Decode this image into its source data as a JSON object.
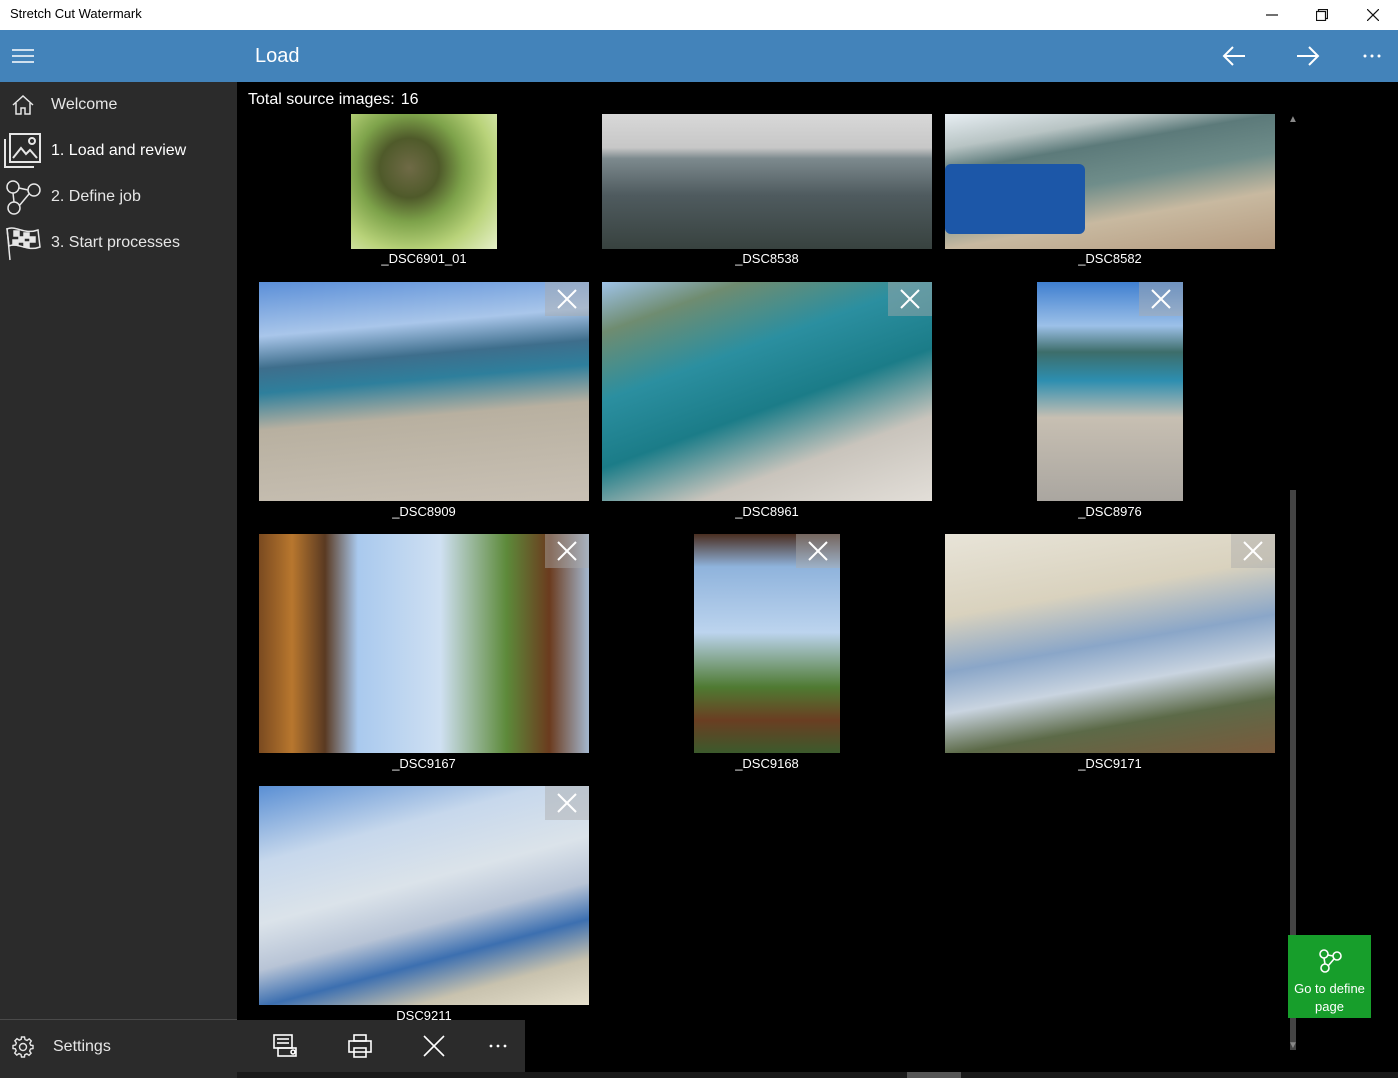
{
  "window": {
    "title": "Stretch Cut Watermark"
  },
  "header": {
    "title": "Load"
  },
  "nav": {
    "items": [
      {
        "label": "Welcome"
      },
      {
        "label": "1. Load and review"
      },
      {
        "label": "2. Define job"
      },
      {
        "label": "3. Start processes"
      }
    ],
    "settings_label": "Settings"
  },
  "main": {
    "total_label": "Total source images:",
    "total_count": "16",
    "images": [
      {
        "name": "_DSC6901_01",
        "scene": "tree",
        "removable": false
      },
      {
        "name": "_DSC8538",
        "scene": "sea-grey",
        "removable": false
      },
      {
        "name": "_DSC8582",
        "scene": "beach-umbrella",
        "removable": false
      },
      {
        "name": "_DSC8909",
        "scene": "beach-crowd",
        "removable": true
      },
      {
        "name": "_DSC8961",
        "scene": "rocks-sea",
        "removable": true
      },
      {
        "name": "_DSC8976",
        "scene": "beach-portrait",
        "removable": true
      },
      {
        "name": "_DSC9167",
        "scene": "palm-frame",
        "removable": true
      },
      {
        "name": "_DSC9168",
        "scene": "palm-frame-portrait",
        "removable": true
      },
      {
        "name": "_DSC9171",
        "scene": "parasols",
        "removable": true
      },
      {
        "name": "DSC9211",
        "scene": "parasol-sky",
        "removable": true
      }
    ]
  },
  "go_define": {
    "line1": "Go to define",
    "line2": "page"
  },
  "colors": {
    "header": "#4383ba",
    "sidebar": "#2b2b2b",
    "accent_green": "#179e2b"
  }
}
